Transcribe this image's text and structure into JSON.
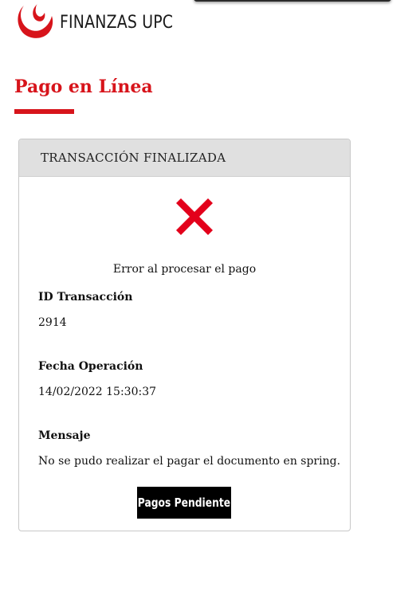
{
  "brand": {
    "name": "FINANZAS UPC",
    "logo_icon": "upc-logo-icon",
    "accent_color": "#d7141b"
  },
  "page": {
    "title": "Pago en Línea"
  },
  "transaction": {
    "header": "TRANSACCIÓN FINALIZADA",
    "status_icon": "error-x-icon",
    "status_message": "Error al procesar el pago",
    "fields": [
      {
        "label": "ID Transacción",
        "value": "2914"
      },
      {
        "label": "Fecha Operación",
        "value": "14/02/2022 15:30:37"
      },
      {
        "label": "Mensaje",
        "value": "No se pudo realizar el pagar el documento en spring."
      }
    ],
    "button_label": "Pagos Pendiente"
  }
}
